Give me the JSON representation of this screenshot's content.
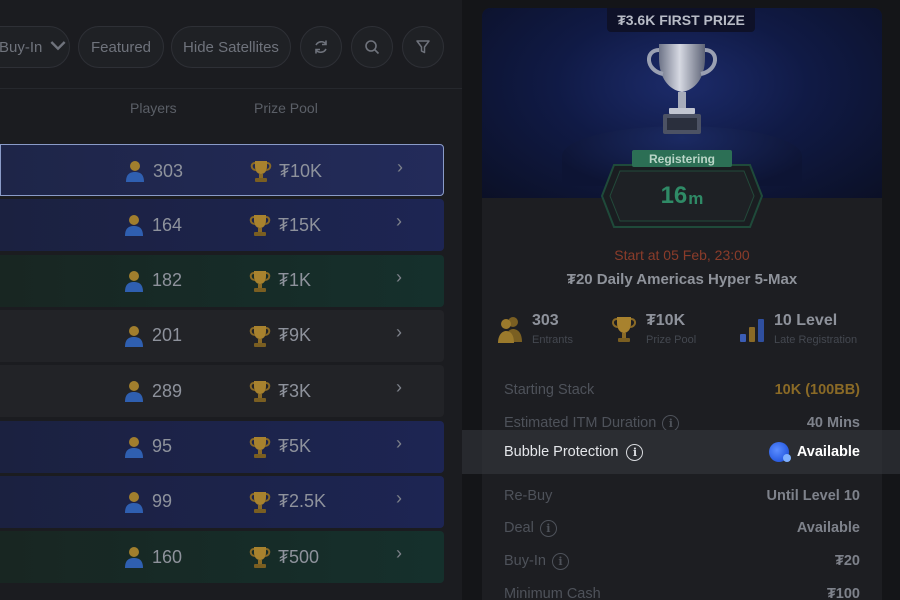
{
  "toolbar": {
    "buyin_label": "Buy-In",
    "featured_label": "Featured",
    "hide_satellites_label": "Hide Satellites",
    "refresh_icon": "refresh-icon",
    "search_icon": "search-icon",
    "filter_icon": "filter-icon"
  },
  "table": {
    "headers": {
      "players": "Players",
      "prize_pool": "Prize Pool"
    },
    "rows": [
      {
        "players": "303",
        "prize": "₮10K",
        "style": "selected"
      },
      {
        "players": "164",
        "prize": "₮15K",
        "style": "navy"
      },
      {
        "players": "182",
        "prize": "₮1K",
        "style": "teal"
      },
      {
        "players": "201",
        "prize": "₮9K",
        "style": "grey"
      },
      {
        "players": "289",
        "prize": "₮3K",
        "style": "grey"
      },
      {
        "players": "95",
        "prize": "₮5K",
        "style": "navy"
      },
      {
        "players": "99",
        "prize": "₮2.5K",
        "style": "navy"
      },
      {
        "players": "160",
        "prize": "₮500",
        "style": "teal"
      }
    ]
  },
  "detail": {
    "first_prize": "₮3.6K FIRST PRIZE",
    "status_badge": "Registering",
    "timer_value": "16",
    "timer_unit": "m",
    "start_at": "Start at 05 Feb, 23:00",
    "name": "₮20 Daily Americas Hyper 5-Max",
    "stats": {
      "entrants_value": "303",
      "entrants_label": "Entrants",
      "prize_value": "₮10K",
      "prize_label": "Prize Pool",
      "level_value": "10 Level",
      "level_label": "Late Registration"
    },
    "rows": {
      "starting_stack_key": "Starting Stack",
      "starting_stack_val": "10K (100BB)",
      "itm_key": "Estimated ITM Duration",
      "itm_val": "40 Mins",
      "bubble_key": "Bubble Protection",
      "bubble_val": "Available",
      "rebuy_key": "Re-Buy",
      "rebuy_val": "Until Level 10",
      "deal_key": "Deal",
      "deal_val": "Available",
      "buyin_key": "Buy-In",
      "buyin_val": "₮20",
      "mincash_key": "Minimum Cash",
      "mincash_val": "₮100"
    }
  },
  "colors": {
    "accent_gold": "#8a6a26",
    "register_green": "#2c6f55",
    "start_red": "#8b3c2a",
    "badge_blue": "#2f62e6"
  }
}
